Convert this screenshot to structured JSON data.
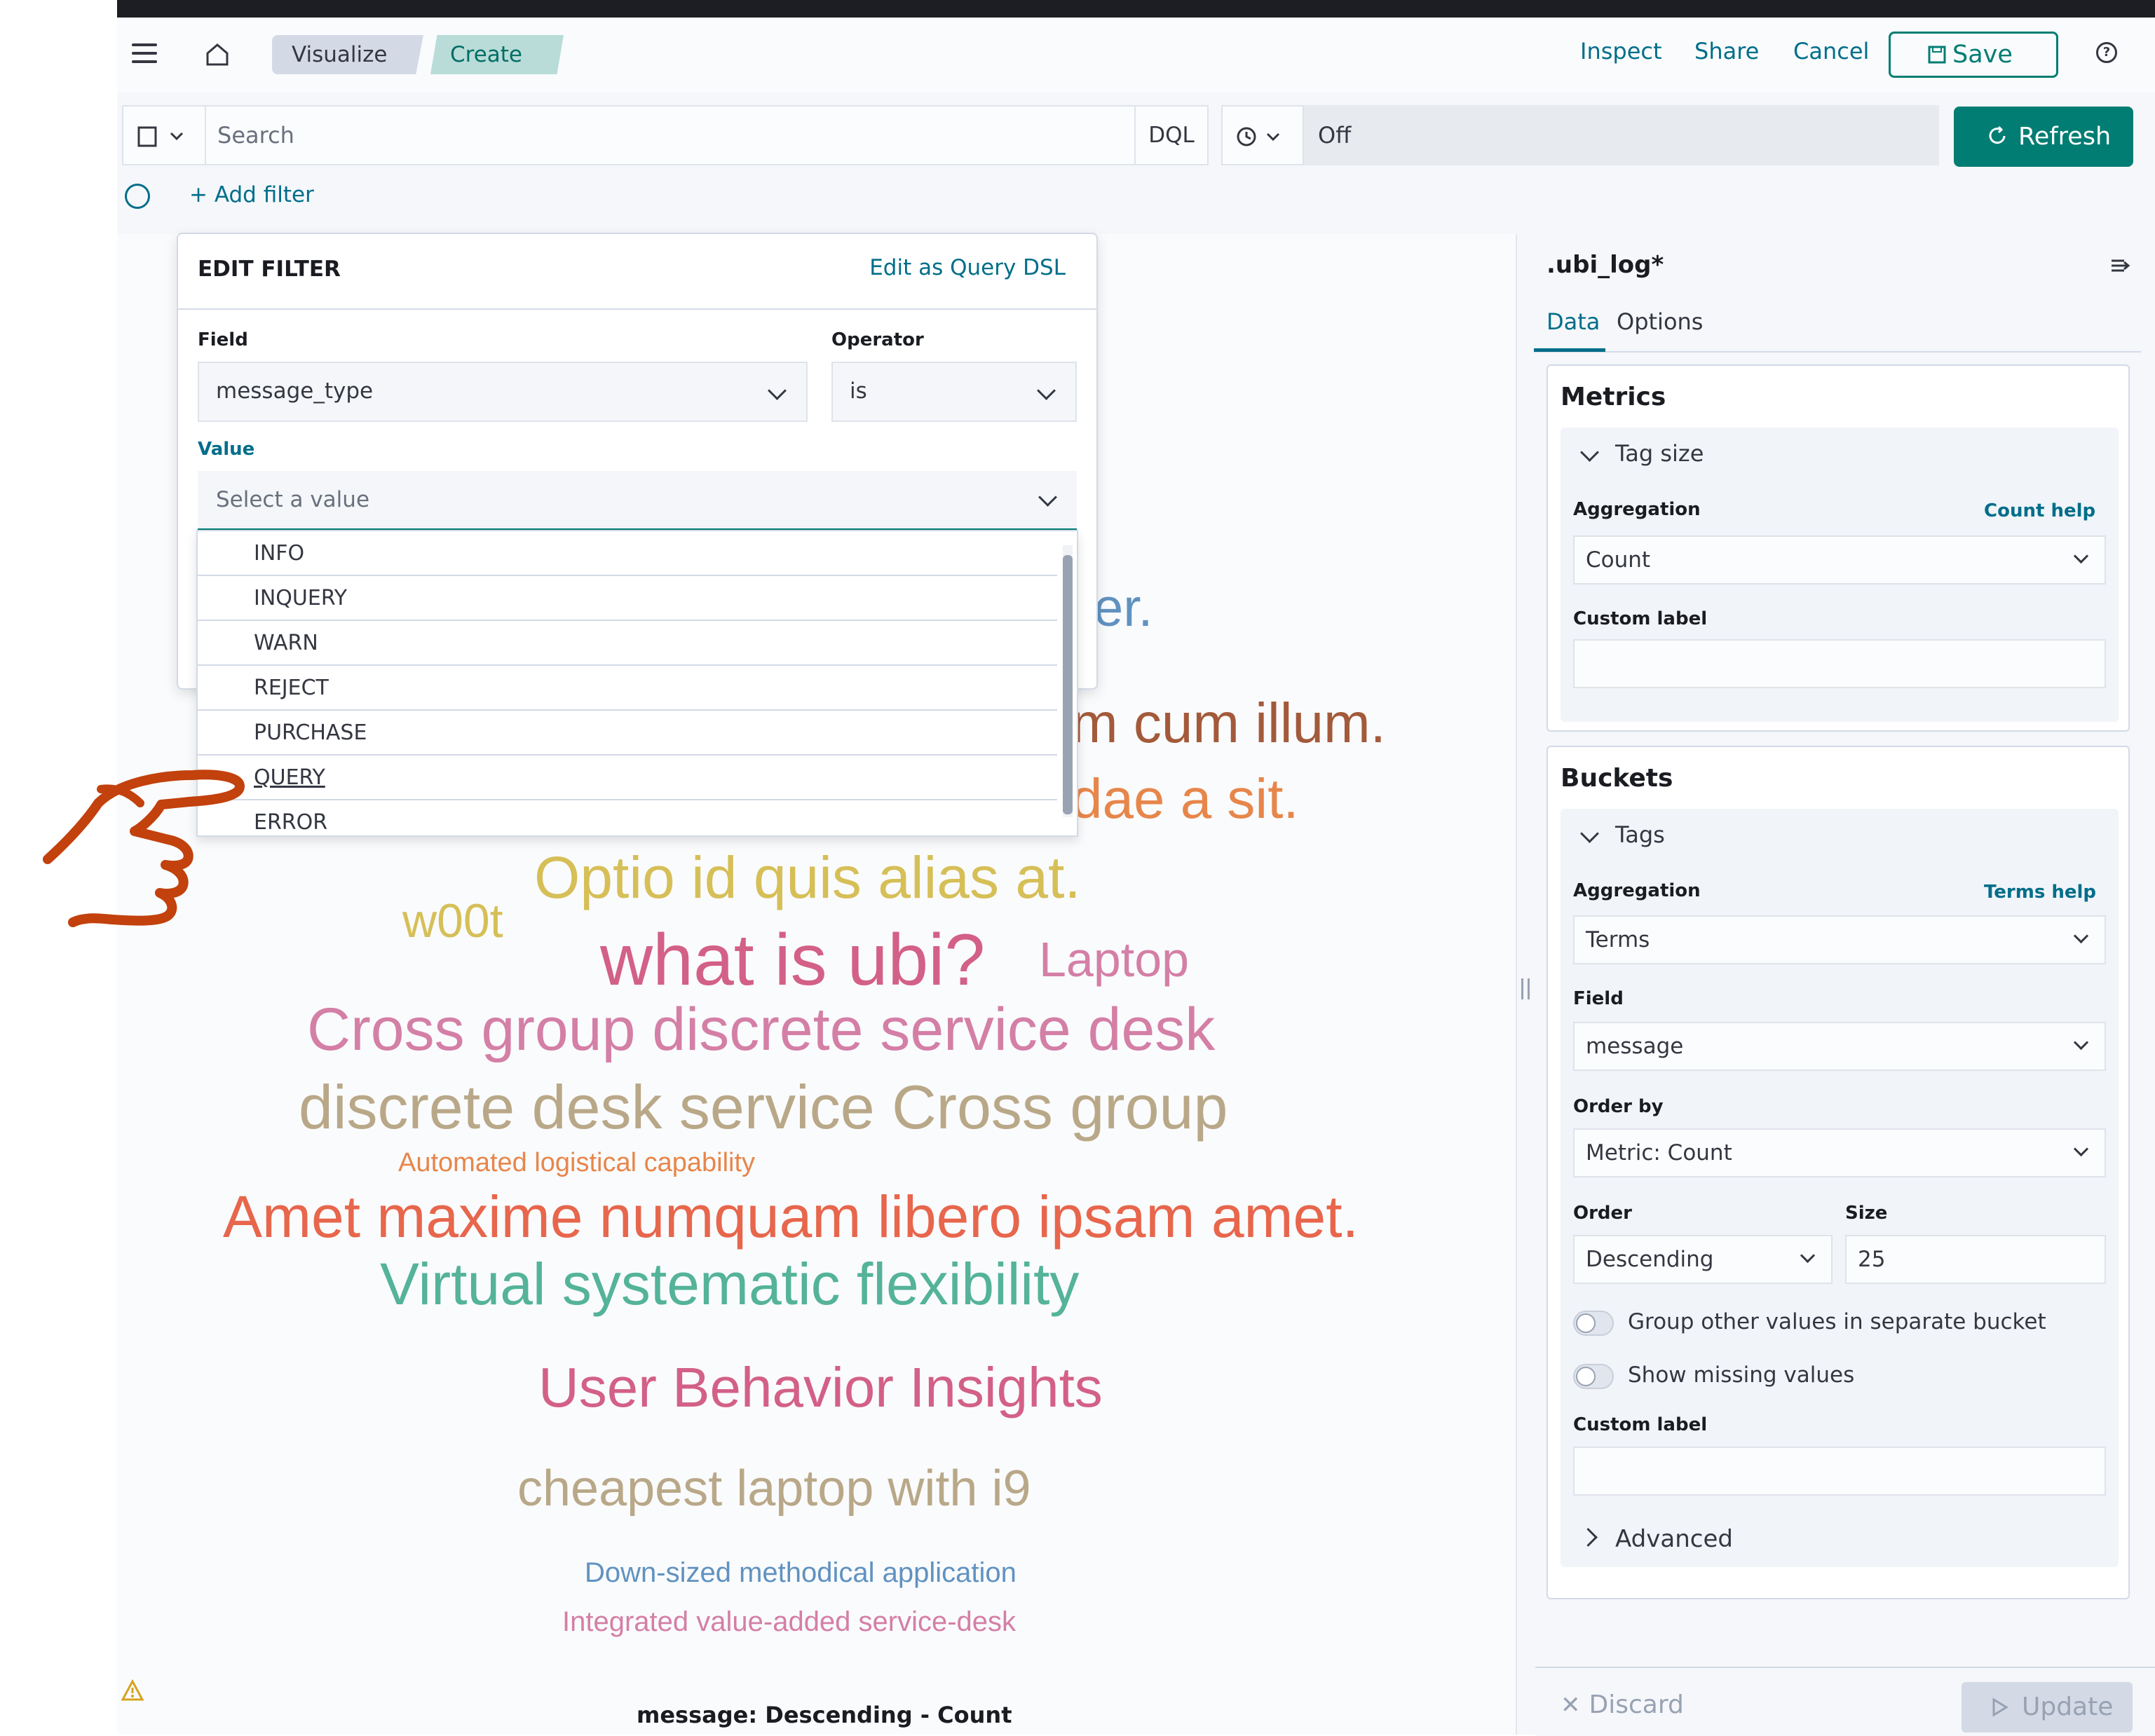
{
  "header": {
    "breadcrumbs": [
      "Visualize",
      "Create"
    ],
    "links": [
      "Inspect",
      "Share",
      "Cancel"
    ],
    "save_label": "Save"
  },
  "query": {
    "search_placeholder": "Search",
    "language": "DQL",
    "refresh_interval": "Off",
    "refresh_label": "Refresh"
  },
  "filters": {
    "add_filter_label": "+ Add filter"
  },
  "edit_filter": {
    "title": "EDIT FILTER",
    "edit_dsl_label": "Edit as Query DSL",
    "field_label": "Field",
    "field_value": "message_type",
    "operator_label": "Operator",
    "operator_value": "is",
    "value_label": "Value",
    "value_placeholder": "Select a value",
    "options": [
      "INFO",
      "INQUERY",
      "WARN",
      "REJECT",
      "PURCHASE",
      "QUERY",
      "ERROR"
    ],
    "hovered_option": "QUERY"
  },
  "wordcloud": {
    "words": [
      {
        "text": "er.",
        "color": "#6092c0"
      },
      {
        "text": "m cum illum.",
        "color": "#a35a3a"
      },
      {
        "text": "dae a sit.",
        "color": "#e7864b"
      },
      {
        "text": "Optio id quis alias at.",
        "color": "#d6bf57"
      },
      {
        "text": "w00t",
        "color": "#d6bf57"
      },
      {
        "text": "what is ubi?",
        "color": "#d36086"
      },
      {
        "text": "Laptop",
        "color": "#d47fa6"
      },
      {
        "text": "Cross group discrete service desk",
        "color": "#d47fa6"
      },
      {
        "text": "discrete desk service Cross group",
        "color": "#b9a888"
      },
      {
        "text": "Automated logistical capability",
        "color": "#e7864b"
      },
      {
        "text": "Amet maxime numquam libero ipsam amet.",
        "color": "#e7664c"
      },
      {
        "text": "Virtual systematic flexibility",
        "color": "#54b399"
      },
      {
        "text": "User Behavior Insights",
        "color": "#d36086"
      },
      {
        "text": "cheapest laptop with i9",
        "color": "#b9a888"
      },
      {
        "text": "Down-sized methodical application",
        "color": "#6092c0"
      },
      {
        "text": "Integrated value-added service-desk",
        "color": "#d47fa6"
      }
    ],
    "caption": "message: Descending - Count"
  },
  "sidebar": {
    "index_pattern": ".ubi_log*",
    "tabs": [
      "Data",
      "Options"
    ],
    "metrics": {
      "title": "Metrics",
      "accordion": "Tag size",
      "aggregation_label": "Aggregation",
      "help": "Count help",
      "aggregation_value": "Count",
      "custom_label": "Custom label"
    },
    "buckets": {
      "title": "Buckets",
      "accordion": "Tags",
      "aggregation_label": "Aggregation",
      "help": "Terms help",
      "aggregation_value": "Terms",
      "field_label": "Field",
      "field_value": "message",
      "order_by_label": "Order by",
      "order_by_value": "Metric: Count",
      "order_label": "Order",
      "order_value": "Descending",
      "size_label": "Size",
      "size_value": "25",
      "group_other": "Group other values in separate bucket",
      "show_missing": "Show missing values",
      "custom_label": "Custom label",
      "advanced": "Advanced"
    },
    "discard_label": "Discard",
    "update_label": "Update"
  },
  "colors": {
    "accent": "#017d73",
    "link": "#006e8a",
    "hand_cursor": "#c2410c"
  }
}
